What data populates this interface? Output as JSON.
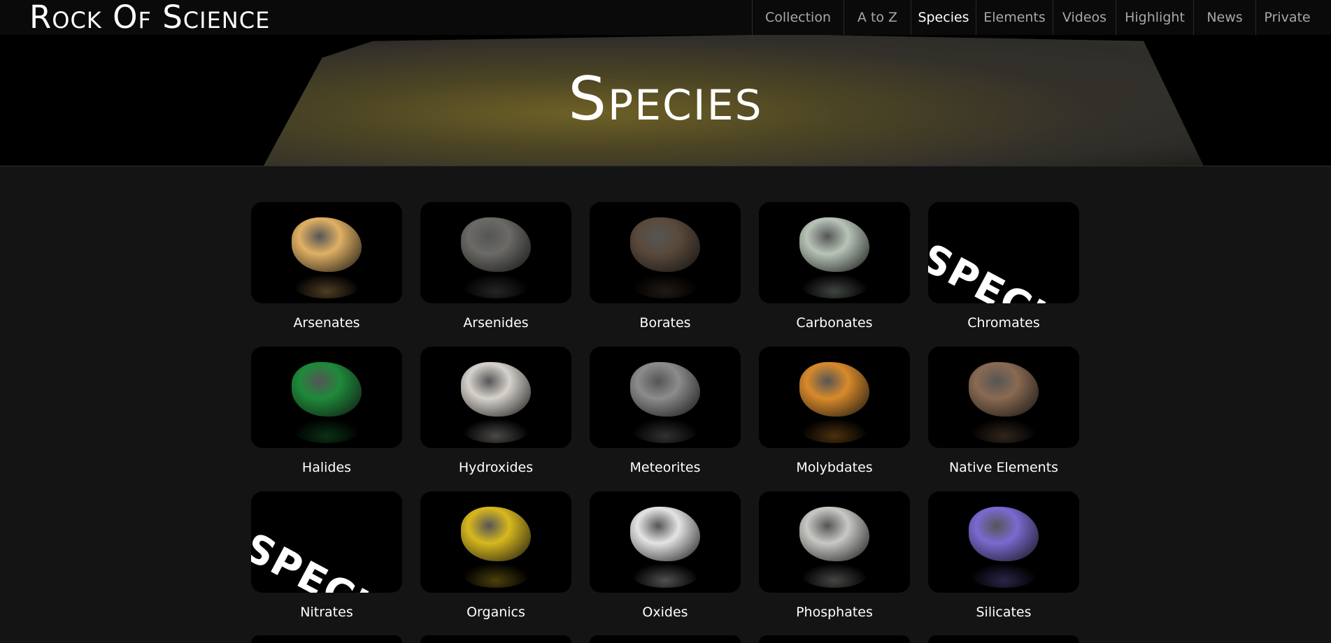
{
  "site": {
    "logo": "Rock Of Science"
  },
  "nav": {
    "items": [
      {
        "label": "Collection",
        "active": false
      },
      {
        "label": "A to Z",
        "active": false
      },
      {
        "label": "Species",
        "active": true
      },
      {
        "label": "Elements",
        "active": false
      },
      {
        "label": "Videos",
        "active": false
      },
      {
        "label": "Highlight",
        "active": false
      },
      {
        "label": "News",
        "active": false
      },
      {
        "label": "Private",
        "active": false
      }
    ]
  },
  "hero": {
    "title": "Species"
  },
  "species": [
    {
      "label": "Arsenates",
      "image": "arsenates-specimen",
      "color": "#e0b064"
    },
    {
      "label": "Arsenides",
      "image": "arsenides-specimen",
      "color": "#6b6a66"
    },
    {
      "label": "Borates",
      "image": "borates-specimen",
      "color": "#5a4a3c"
    },
    {
      "label": "Carbonates",
      "image": "carbonates-specimen",
      "color": "#b8c4b8"
    },
    {
      "label": "Chromates",
      "image": "placeholder",
      "placeholder_text": "SPECIES"
    },
    {
      "label": "Halides",
      "image": "halides-specimen",
      "color": "#1e8a3a"
    },
    {
      "label": "Hydroxides",
      "image": "hydroxides-specimen",
      "color": "#d6d2cc"
    },
    {
      "label": "Meteorites",
      "image": "meteorites-specimen",
      "color": "#8c8c8c"
    },
    {
      "label": "Molybdates",
      "image": "molybdates-specimen",
      "color": "#d88a2a"
    },
    {
      "label": "Native Elements",
      "image": "native-elements-specimen",
      "color": "#8a6a52"
    },
    {
      "label": "Nitrates",
      "image": "placeholder",
      "placeholder_text": "SPECIES"
    },
    {
      "label": "Organics",
      "image": "organics-specimen",
      "color": "#d8b81e"
    },
    {
      "label": "Oxides",
      "image": "oxides-specimen",
      "color": "#e4e4e4"
    },
    {
      "label": "Phosphates",
      "image": "phosphates-specimen",
      "color": "#c8c8c4"
    },
    {
      "label": "Silicates",
      "image": "silicates-specimen",
      "color": "#7a6ad0"
    }
  ]
}
